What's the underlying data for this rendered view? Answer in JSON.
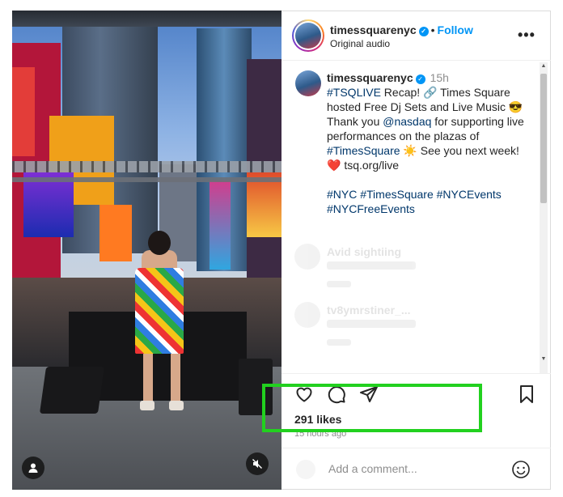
{
  "colors": {
    "accent": "#0095f6",
    "hashtag": "#00376b",
    "highlight_box": "#22d11f",
    "secondary_text": "#8e8e8e"
  },
  "post": {
    "username": "timessquarenyc",
    "follow_label": "Follow",
    "dot": "•",
    "audio_label": "Original audio",
    "more_label": "•••",
    "verified_icon": "verified-badge-icon"
  },
  "caption": {
    "username": "timessquarenyc",
    "time": "15h",
    "tag1": "#TSQLIVE",
    "text1": " Recap! 🔗 Times Square hosted Free Dj Sets and Live Music 😎 Thank you ",
    "mention": "@nasdaq",
    "text2": " for supporting live performances on the plazas of ",
    "tag2": "#TimesSquare",
    "text3": " ☀️  See you next week!",
    "link_line": "❤️ tsq.org/live",
    "tags_line1": "#NYC #TimesSquare #NYCEvents",
    "tags_line2": "#NYCFreeEvents"
  },
  "comments": [
    {
      "username": "Avid sightiing"
    },
    {
      "username": "tv8ymrstiner_..."
    }
  ],
  "actions": {
    "likes": "291 likes",
    "ago": "15 hours ago"
  },
  "add_comment": {
    "placeholder": "Add a comment..."
  }
}
